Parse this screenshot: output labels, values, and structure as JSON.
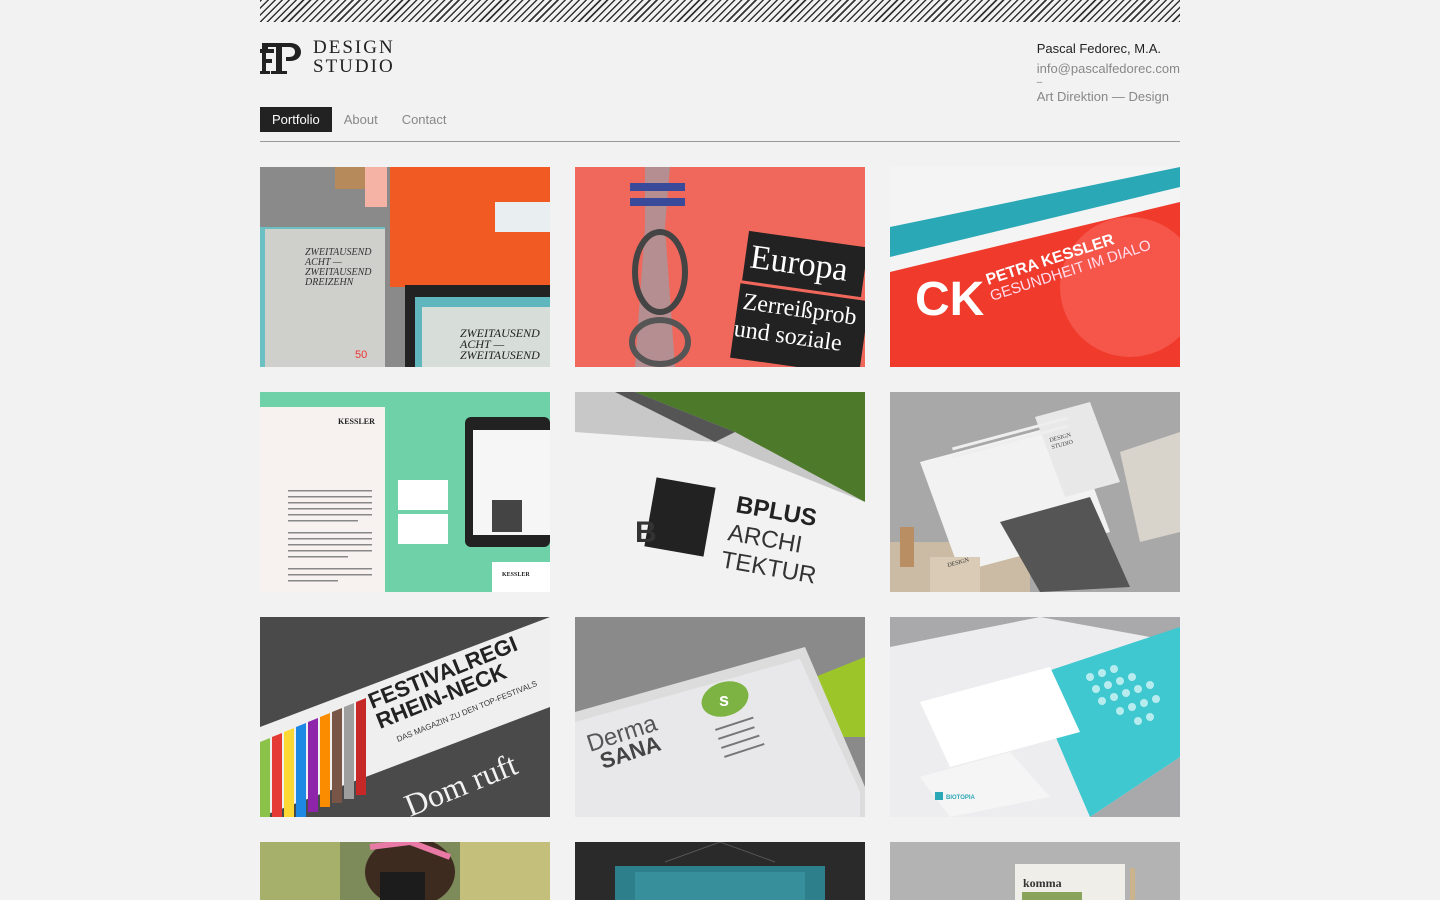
{
  "logo": {
    "line1": "DESIGN",
    "line2": "STUDIO"
  },
  "contact": {
    "name": "Pascal Fedorec, M.A.",
    "email": "info@pascalfedorec.com",
    "separator": "–",
    "role": "Art Direktion — Design"
  },
  "nav": {
    "items": [
      {
        "label": "Portfolio",
        "active": true
      },
      {
        "label": "About",
        "active": false
      },
      {
        "label": "Contact",
        "active": false
      }
    ]
  },
  "portfolio": {
    "tiles": [
      {
        "name": "tile-zweitausend-acht",
        "texts": [
          "ZWEITAUSEND",
          "ACHT —",
          "ZWEITAUSEND",
          "DREIZEHN",
          "50"
        ]
      },
      {
        "name": "tile-europa",
        "texts": [
          "Europa",
          "Zerreißprob",
          "und soziale"
        ]
      },
      {
        "name": "tile-petra-kessler",
        "texts": [
          "PETRA KESSLER",
          "GESUNDHEIT IM DIALO"
        ]
      },
      {
        "name": "tile-kessler-letterhead",
        "texts": [
          "KESSLER"
        ]
      },
      {
        "name": "tile-bplus-architektur",
        "texts": [
          "BPLUS",
          "ARCHI",
          "TEKTUR"
        ]
      },
      {
        "name": "tile-design-studio-stationery",
        "texts": [
          "DESIGN",
          "STUDIO"
        ]
      },
      {
        "name": "tile-festivalregion",
        "texts": [
          "FESTIVALREGI",
          "RHEIN-NECK",
          "DAS MAGAZIN ZU DEN TOP-FESTIVALS",
          "Dom ruft"
        ]
      },
      {
        "name": "tile-derma-sana",
        "texts": [
          "Derma",
          "SANA"
        ]
      },
      {
        "name": "tile-biotopia",
        "texts": [
          "BIOTOPIA"
        ]
      },
      {
        "name": "tile-partial-1",
        "texts": []
      },
      {
        "name": "tile-partial-2",
        "texts": []
      },
      {
        "name": "tile-komma",
        "texts": [
          "komma"
        ]
      }
    ]
  },
  "colors": {
    "background": "#f2f2f2",
    "text_dark": "#222222",
    "text_muted": "#888888",
    "nav_active_bg": "#222222"
  }
}
